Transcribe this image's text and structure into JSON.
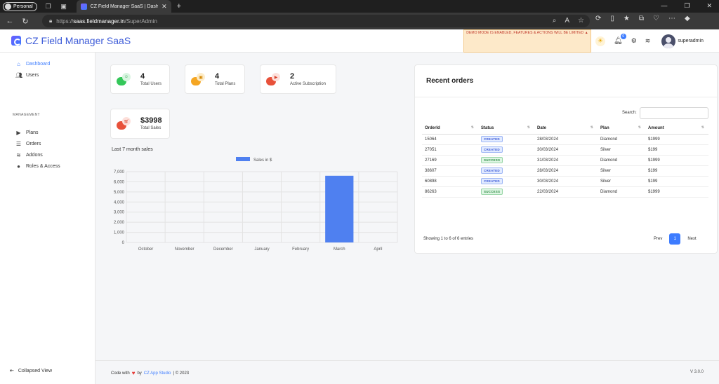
{
  "browser": {
    "profile_label": "Personal",
    "tab_title": "CZ Field Manager SaaS | Dashbo",
    "url_scheme": "https://",
    "url_host": "saas.fieldmanager.in",
    "url_path": "/SuperAdmin"
  },
  "header": {
    "brand": "CZ Field Manager SaaS",
    "demo_notice": "DEMO MODE IS ENABLED, FEATURES & ACTIONS WILL BE LIMITED",
    "notification_count": "0",
    "username": "superadmin"
  },
  "sidebar": {
    "items": [
      {
        "label": "Dashboard",
        "icon": "home-icon"
      },
      {
        "label": "Users",
        "icon": "users-icon"
      }
    ],
    "section_label": "MANAGEMENT",
    "mgmt_items": [
      {
        "label": "Plans",
        "icon": "video-icon"
      },
      {
        "label": "Orders",
        "icon": "list-icon"
      },
      {
        "label": "Addons",
        "icon": "layers-icon"
      },
      {
        "label": "Roles & Access",
        "icon": "info-icon"
      }
    ],
    "collapse_label": "Collapsed View"
  },
  "stats": [
    {
      "value": "4",
      "label": "Total Users",
      "color": "#34c759"
    },
    {
      "value": "4",
      "label": "Total Plans",
      "color": "#f5a623"
    },
    {
      "value": "2",
      "label": "Active Subscription",
      "color": "#e8513a"
    },
    {
      "value": "$3998",
      "label": "Total Sales",
      "color": "#e8513a"
    }
  ],
  "chart_title": "Last 7 month sales",
  "chart_data": {
    "type": "bar",
    "categories": [
      "October",
      "November",
      "December",
      "January",
      "February",
      "March",
      "April"
    ],
    "series": [
      {
        "name": "Sales in $",
        "values": [
          0,
          0,
          0,
          0,
          0,
          6597,
          0
        ]
      }
    ],
    "ylim": [
      0,
      7000
    ],
    "yticks": [
      "0",
      "1,000",
      "2,000",
      "3,000",
      "4,000",
      "5,000",
      "6,000",
      "7,000"
    ],
    "color": "#4f80f0",
    "legend": "top-center",
    "grid": true
  },
  "orders": {
    "title": "Recent orders",
    "search_label": "Search:",
    "columns": [
      "OrderId",
      "Status",
      "Date",
      "Plan",
      "Amount"
    ],
    "rows": [
      {
        "id": "15064",
        "status": "CREATED",
        "date": "28/03/2024",
        "plan": "Diamond",
        "amount": "$1999"
      },
      {
        "id": "27051",
        "status": "CREATED",
        "date": "30/03/2024",
        "plan": "Silver",
        "amount": "$199"
      },
      {
        "id": "27169",
        "status": "SUCCESS",
        "date": "31/03/2024",
        "plan": "Diamond",
        "amount": "$1999"
      },
      {
        "id": "38607",
        "status": "CREATED",
        "date": "28/03/2024",
        "plan": "Silver",
        "amount": "$199"
      },
      {
        "id": "60898",
        "status": "CREATED",
        "date": "30/03/2024",
        "plan": "Silver",
        "amount": "$199"
      },
      {
        "id": "86263",
        "status": "SUCCESS",
        "date": "22/03/2024",
        "plan": "Diamond",
        "amount": "$1999"
      }
    ],
    "showing": "Showing 1 to 6 of 6 entries",
    "prev": "Prev",
    "page": "1",
    "next": "Next"
  },
  "footer": {
    "code_with": "Code with",
    "by": "by",
    "studio": "CZ App Studio",
    "copyright": "| © 2023",
    "version": "V 3.0.0"
  }
}
